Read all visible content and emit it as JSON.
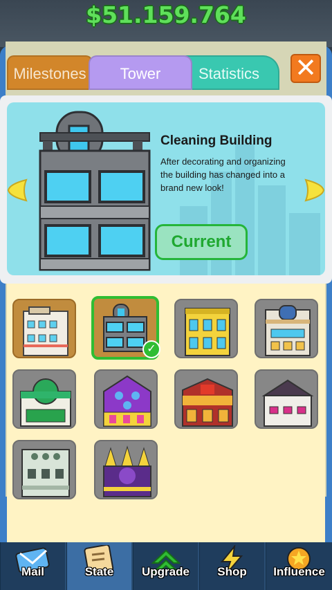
{
  "header": {
    "money": "$51.159.764"
  },
  "tabs": [
    {
      "label": "Milestones",
      "state": "inactive"
    },
    {
      "label": "Tower",
      "state": "active"
    },
    {
      "label": "Statistics",
      "state": "inactive"
    }
  ],
  "close_icon": "close-x-icon",
  "feature": {
    "title": "Cleaning Building",
    "description": "After decorating and organizing the building has changed into a brand new look!",
    "button_label": "Current"
  },
  "buildings": [
    {
      "name": "building-1",
      "state": "unlocked"
    },
    {
      "name": "building-2",
      "state": "selected"
    },
    {
      "name": "building-3",
      "state": "locked"
    },
    {
      "name": "building-4",
      "state": "locked"
    },
    {
      "name": "building-5",
      "state": "locked"
    },
    {
      "name": "building-6",
      "state": "locked"
    },
    {
      "name": "building-7",
      "state": "locked"
    },
    {
      "name": "building-8",
      "state": "locked"
    },
    {
      "name": "building-9",
      "state": "locked"
    },
    {
      "name": "building-10",
      "state": "locked"
    }
  ],
  "nav": [
    {
      "label": "Mail",
      "icon": "mail-icon"
    },
    {
      "label": "State",
      "icon": "state-scroll-icon",
      "active": true
    },
    {
      "label": "Upgrade",
      "icon": "upgrade-arrows-icon"
    },
    {
      "label": "Shop",
      "icon": "shop-lightning-icon"
    },
    {
      "label": "Influence",
      "icon": "influence-star-icon"
    }
  ],
  "colors": {
    "money": "#5fe05a",
    "tab_milestones": "#d2862a",
    "tab_tower": "#b59af0",
    "tab_statistics": "#39c8b0",
    "current_button": "#25b53a",
    "selected_tile_border": "#2fbd33"
  }
}
